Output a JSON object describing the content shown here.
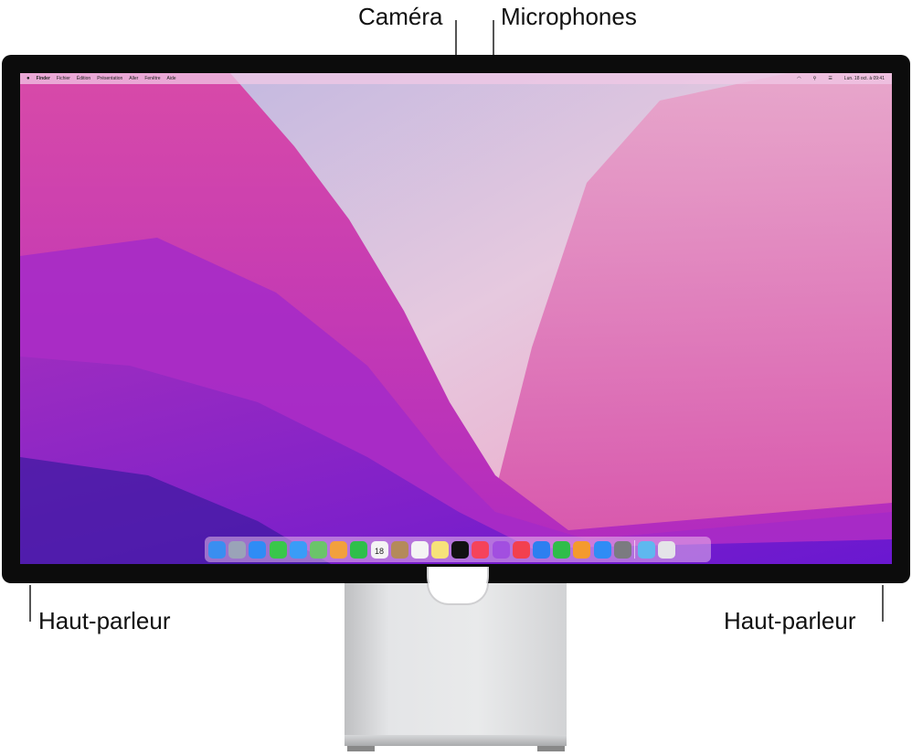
{
  "labels": {
    "camera": "Caméra",
    "microphones": "Microphones",
    "speaker_left": "Haut-parleur",
    "speaker_right": "Haut-parleur"
  },
  "menubar": {
    "apple": "",
    "items": [
      "Finder",
      "Fichier",
      "Édition",
      "Présentation",
      "Aller",
      "Fenêtre",
      "Aide"
    ],
    "clock": "Lun. 18 oct. à 09:41"
  },
  "dock": {
    "icons": [
      {
        "name": "finder",
        "color": "#3a8ef0"
      },
      {
        "name": "launchpad",
        "color": "#9aa3b8"
      },
      {
        "name": "safari",
        "color": "#2f8cf5"
      },
      {
        "name": "messages",
        "color": "#39c74a"
      },
      {
        "name": "mail",
        "color": "#3a9cf7"
      },
      {
        "name": "maps",
        "color": "#6bc46a"
      },
      {
        "name": "photos",
        "color": "#f2a03d"
      },
      {
        "name": "facetime",
        "color": "#2fbf4b"
      },
      {
        "name": "calendar",
        "color": "#f4f4f4",
        "text": "18"
      },
      {
        "name": "contacts",
        "color": "#b48a5a"
      },
      {
        "name": "reminders",
        "color": "#f4f4f4"
      },
      {
        "name": "notes",
        "color": "#f7e27a"
      },
      {
        "name": "tv",
        "color": "#111111"
      },
      {
        "name": "music",
        "color": "#f5435b"
      },
      {
        "name": "podcasts",
        "color": "#a24fe0"
      },
      {
        "name": "news",
        "color": "#f2404f"
      },
      {
        "name": "keynote",
        "color": "#2d7ff0"
      },
      {
        "name": "numbers",
        "color": "#2fbd4a"
      },
      {
        "name": "pages",
        "color": "#f49a2e"
      },
      {
        "name": "app-store",
        "color": "#2f8cf5"
      },
      {
        "name": "system-preferences",
        "color": "#7b7b80"
      },
      {
        "name": "downloads",
        "color": "#5fb8ef"
      },
      {
        "name": "trash",
        "color": "#e4e4e8"
      }
    ]
  }
}
